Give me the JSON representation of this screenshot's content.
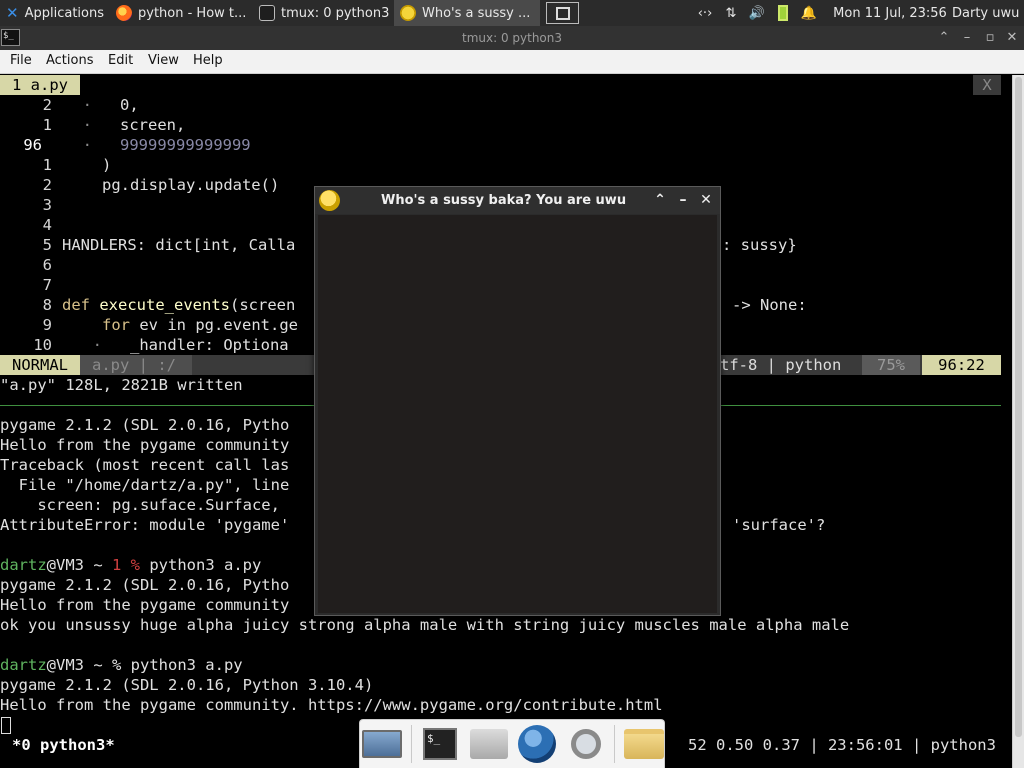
{
  "panel": {
    "applications_label": "Applications",
    "applications_suffix": "≡",
    "tasks": [
      {
        "label": "python - How t...",
        "icon": "firefox-icon"
      },
      {
        "label": "tmux: 0 python3",
        "icon": "terminal-icon"
      },
      {
        "label": "Who's a sussy ...",
        "icon": "pygame-icon"
      }
    ],
    "clock": "Mon 11 Jul, 23:56",
    "user": "Darty uwu",
    "tray_icons": [
      "network-icon",
      "transfer-icon",
      "volume-icon",
      "battery-icon",
      "notification-bell-icon"
    ]
  },
  "terminal_window": {
    "title": "tmux: 0 python3",
    "menu": [
      "File",
      "Actions",
      "Edit",
      "View",
      "Help"
    ]
  },
  "vim": {
    "tab_label": "1 a.py",
    "tab_close": "X",
    "lines": [
      {
        "num": "2",
        "dot": "·",
        "text": "   0,"
      },
      {
        "num": "1",
        "dot": "·",
        "text": "   screen,"
      },
      {
        "num": "96",
        "dot": "·",
        "text": "   99999999999999"
      },
      {
        "num": "1",
        "dot": "",
        "text": ")"
      },
      {
        "num": "2",
        "dot": "",
        "text": "pg.display.update()"
      },
      {
        "num": "3",
        "dot": "",
        "text": ""
      },
      {
        "num": "4",
        "dot": "",
        "text": ""
      },
      {
        "num": "5",
        "dot": "",
        "text": "HANDLERS: dict[int, Calla",
        "tail": ": sussy}"
      },
      {
        "num": "6",
        "dot": "",
        "text": ""
      },
      {
        "num": "7",
        "dot": "",
        "text": ""
      },
      {
        "num": "8",
        "dot": "",
        "kw": "def",
        "fnname": "execute_events",
        "text": "(screen",
        "tail": "-> None:"
      },
      {
        "num": "9",
        "dot": "",
        "kw": "for",
        "text": "ev in pg.event.ge"
      },
      {
        "num": "10",
        "dot": "·",
        "text": "   _handler: Optiona"
      }
    ],
    "status_mode": "NORMAL",
    "status_file": "a.py | :/",
    "status_encoding": "tf-8 | python",
    "status_percent": "75%",
    "status_position": "96:22",
    "message": "\"a.py\" 128L, 2821B written"
  },
  "shell": {
    "lines": [
      "pygame 2.1.2 (SDL 2.0.16, Pytho",
      "Hello from the pygame community",
      "Traceback (most recent call las",
      "  File \"/home/dartz/a.py\", line",
      "    screen: pg.suface.Surface,",
      "AttributeError: module 'pygame'"
    ],
    "error_tail": "'surface'?",
    "prompt1_user": "dartz",
    "prompt1_host": "@VM3 ~ ",
    "prompt1_code": "1 %",
    "prompt1_cmd": " python3 a.py",
    "run2_lines": [
      "pygame 2.1.2 (SDL 2.0.16, Pytho",
      "Hello from the pygame community"
    ],
    "output_line": "ok you unsussy huge alpha juicy strong alpha male with string juicy muscles male alpha male",
    "prompt2_user": "dartz",
    "prompt2_rest": "@VM3 ~ % python3 a.py",
    "run3_lines": [
      "pygame 2.1.2 (SDL 2.0.16, Python 3.10.4)",
      "Hello from the pygame community. https://www.pygame.org/contribute.html"
    ]
  },
  "tmux": {
    "window_label": "*0 python3*",
    "status_right": "52 0.50 0.37 | 23:56:01 | python3"
  },
  "pygame_window": {
    "title": "Who's a sussy baka? You are uwu",
    "canvas_color": "#211e1d"
  },
  "dock": {
    "items": [
      "show-desktop-icon",
      "terminal-icon",
      "home-folder-icon",
      "web-browser-icon",
      "search-icon",
      "folder-icon"
    ]
  },
  "colors": {
    "panel_bg": "#2b2b2b",
    "prompt_green": "#5fb35f",
    "error_red": "#d04040",
    "vim_tab_bg": "#d7d7a7"
  }
}
